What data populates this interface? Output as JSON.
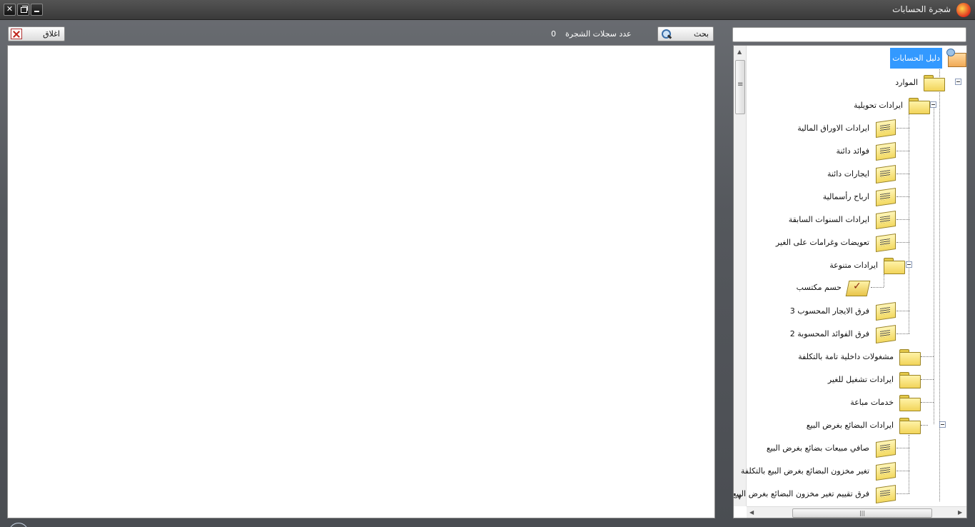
{
  "window": {
    "title": "شجرة الحسابات",
    "controls": {
      "close": "✕",
      "restore": "",
      "minimize": ""
    }
  },
  "toolbar": {
    "close_label": "اغلاق",
    "search_label": "بحث",
    "records_count_label": "عدد سجلات الشجرة",
    "records_count_value": "0",
    "search_value": ""
  },
  "tree": {
    "root": "دليل الحسابات",
    "items": [
      {
        "label": "الموارد",
        "icon": "folder-icon"
      },
      {
        "label": "ايرادات تحويلية",
        "icon": "folder-icon"
      },
      {
        "label": "ايرادات الاوراق المالية",
        "icon": "document-icon"
      },
      {
        "label": "فوائد دائنة",
        "icon": "document-icon"
      },
      {
        "label": "ايجارات دائنة",
        "icon": "document-icon"
      },
      {
        "label": "ارباح رأسمالية",
        "icon": "document-icon"
      },
      {
        "label": "ايرادات السنوات السابقة",
        "icon": "document-icon"
      },
      {
        "label": "تعويضات وغرامات على الغير",
        "icon": "document-icon"
      },
      {
        "label": "ايرادات متنوعة",
        "icon": "folder-icon"
      },
      {
        "label": "حسم مكتسب",
        "icon": "checked-folder-icon"
      },
      {
        "label": "فرق الايجار المحسوب 3",
        "icon": "document-icon"
      },
      {
        "label": "فرق الفوائد المحسوبة 2",
        "icon": "document-icon"
      },
      {
        "label": "مشغولات داخلية تامة بالتكلفة",
        "icon": "folder-icon"
      },
      {
        "label": "ايرادات تشغيل للغير",
        "icon": "folder-icon"
      },
      {
        "label": "خدمات مباعة",
        "icon": "folder-icon"
      },
      {
        "label": "ايرادات البضائع بغرض البيع",
        "icon": "folder-icon"
      },
      {
        "label": "صافي مبيعات بضائع بغرض البيع",
        "icon": "document-icon"
      },
      {
        "label": "تغير مخزون البضائع بغرض البيع بالتكلفة",
        "icon": "document-icon"
      },
      {
        "label": "فرق تقييم تغير مخزون البضائع بغرض البيع",
        "icon": "document-icon"
      }
    ]
  },
  "colors": {
    "selection": "#3399ff",
    "background": "#5a5d62",
    "titlebar": "#454545"
  }
}
